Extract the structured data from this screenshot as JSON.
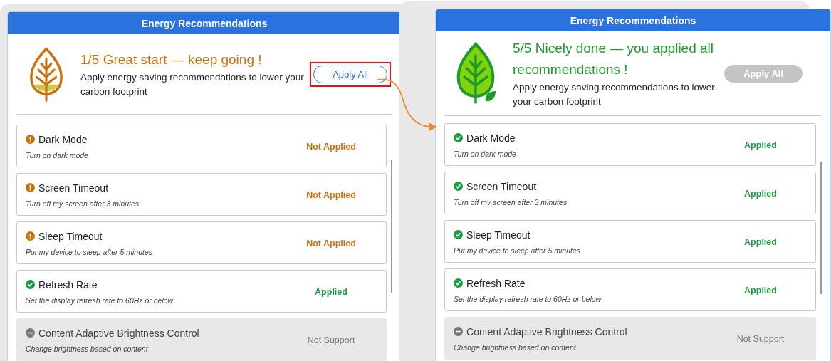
{
  "panels": [
    {
      "title": "Energy Recommendations",
      "all_applied": false,
      "progress": "1/5",
      "message": "Great start — keep going !",
      "subtitle": "Apply energy saving recommendations to lower your carbon footprint",
      "apply_all": {
        "label": "Apply All",
        "disabled": false,
        "highlighted": true
      },
      "items": [
        {
          "name": "Dark Mode",
          "description": "Turn on dark mode",
          "status": "Not Applied",
          "kind": "not_applied"
        },
        {
          "name": "Screen Timeout",
          "description": "Turn off my screen after 3 minutes",
          "status": "Not Applied",
          "kind": "not_applied"
        },
        {
          "name": "Sleep Timeout",
          "description": "Put my device to sleep after 5 minutes",
          "status": "Not Applied",
          "kind": "not_applied"
        },
        {
          "name": "Refresh Rate",
          "description": "Set the display refresh rate to 60Hz or below",
          "status": "Applied",
          "kind": "applied"
        },
        {
          "name": "Content Adaptive Brightness Control",
          "description": "Change brightness based on content",
          "status": "Not Support",
          "kind": "not_supported"
        }
      ]
    },
    {
      "title": "Energy Recommendations",
      "all_applied": true,
      "progress": "5/5",
      "message": "Nicely done — you applied all recommendations !",
      "subtitle": "Apply energy saving recommendations to lower your carbon footprint",
      "apply_all": {
        "label": "Apply All",
        "disabled": true,
        "highlighted": false
      },
      "items": [
        {
          "name": "Dark Mode",
          "description": "Turn on dark mode",
          "status": "Applied",
          "kind": "applied"
        },
        {
          "name": "Screen Timeout",
          "description": "Turn off my screen after 3 minutes",
          "status": "Applied",
          "kind": "applied"
        },
        {
          "name": "Sleep Timeout",
          "description": "Put my device to sleep after 5 minutes",
          "status": "Applied",
          "kind": "applied"
        },
        {
          "name": "Refresh Rate",
          "description": "Set the display refresh rate to 60Hz or below",
          "status": "Applied",
          "kind": "applied"
        },
        {
          "name": "Content Adaptive Brightness Control",
          "description": "Change brightness based on content",
          "status": "Not Support",
          "kind": "not_supported"
        }
      ]
    }
  ]
}
